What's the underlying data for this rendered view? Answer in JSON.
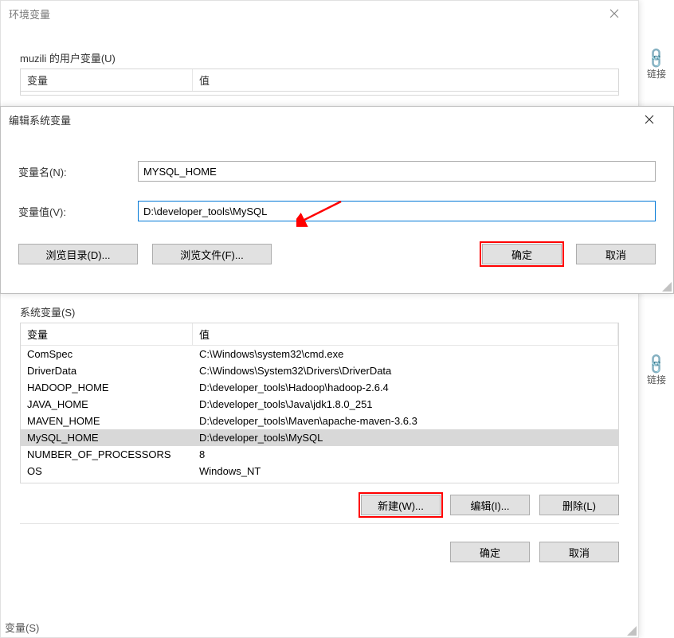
{
  "env_window": {
    "title": "环境变量",
    "user_section_label": "muzili 的用户变量(U)",
    "col_var": "变量",
    "col_val": "值",
    "sys_section_label": "系统变量(S)",
    "sys_rows": [
      {
        "var": "ComSpec",
        "val": "C:\\Windows\\system32\\cmd.exe"
      },
      {
        "var": "DriverData",
        "val": "C:\\Windows\\System32\\Drivers\\DriverData"
      },
      {
        "var": "HADOOP_HOME",
        "val": "D:\\developer_tools\\Hadoop\\hadoop-2.6.4"
      },
      {
        "var": "JAVA_HOME",
        "val": "D:\\developer_tools\\Java\\jdk1.8.0_251"
      },
      {
        "var": "MAVEN_HOME",
        "val": "D:\\developer_tools\\Maven\\apache-maven-3.6.3"
      },
      {
        "var": "MySQL_HOME",
        "val": "D:\\developer_tools\\MySQL"
      },
      {
        "var": "NUMBER_OF_PROCESSORS",
        "val": "8"
      },
      {
        "var": "OS",
        "val": "Windows_NT"
      }
    ],
    "btn_new": "新建(W)...",
    "btn_edit": "编辑(I)...",
    "btn_delete": "删除(L)",
    "btn_ok": "确定",
    "btn_cancel": "取消"
  },
  "edit_dialog": {
    "title": "编辑系统变量",
    "name_label": "变量名(N):",
    "name_value": "MYSQL_HOME",
    "value_label": "变量值(V):",
    "value_value": "D:\\developer_tools\\MySQL",
    "btn_browse_dir": "浏览目录(D)...",
    "btn_browse_file": "浏览文件(F)...",
    "btn_ok": "确定",
    "btn_cancel": "取消"
  },
  "side": {
    "link_label": "链接"
  },
  "bottom_partial": "变量(S)",
  "annotations": {
    "arrow_points_to": "value_input",
    "highlighted_buttons": [
      "edit_dialog_ok",
      "sys_new"
    ]
  }
}
